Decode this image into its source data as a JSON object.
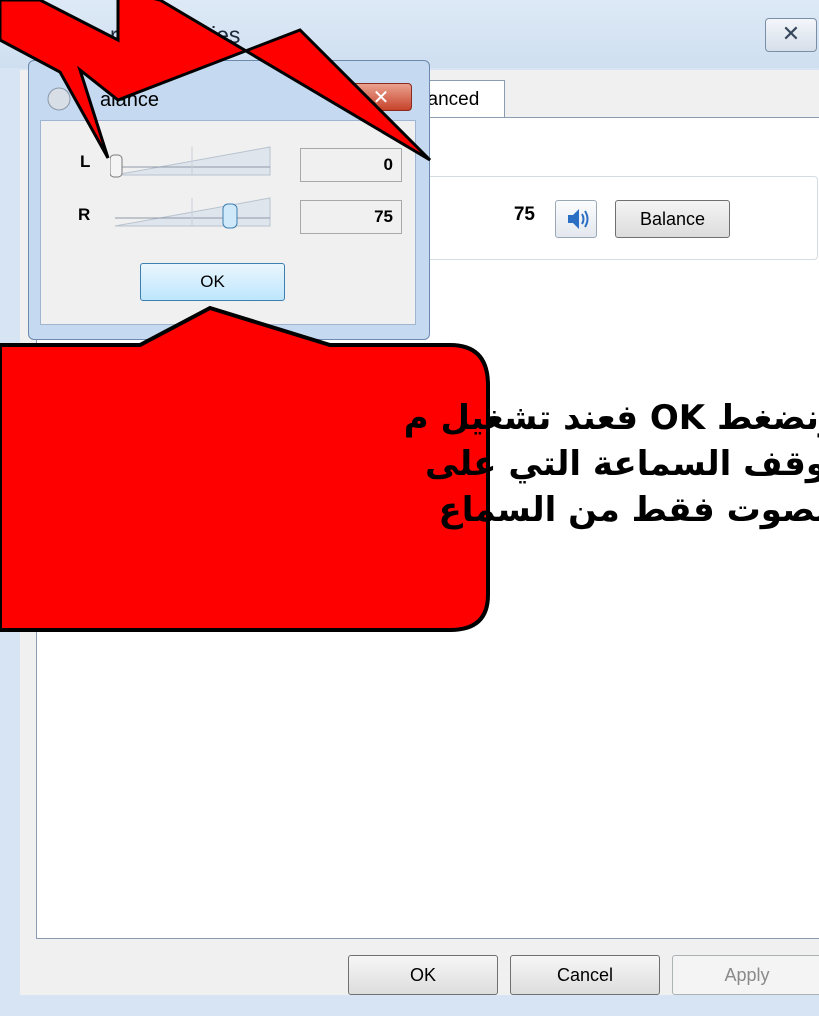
{
  "properties_window": {
    "title": "Speakers Properties",
    "title_visible": "rs Properties",
    "close_glyph": "✕",
    "tab_label": "Advanced",
    "tab_label_visible": "vanced",
    "level_value": "75",
    "balance_button": "Balance",
    "ok_button": "OK",
    "cancel_button": "Cancel",
    "apply_button": "Apply"
  },
  "balance_dialog": {
    "title": "Balance",
    "title_visible": "alance",
    "close_glyph": "✕",
    "channels": [
      {
        "label": "L",
        "value": "0",
        "level_percent": 0
      },
      {
        "label": "R",
        "value": "75",
        "level_percent": 75
      }
    ],
    "ok_button": "OK"
  },
  "callout": {
    "lines": [
      "ونضغط OK فعند تشغيل م",
      "توقف السماعة التي على",
      "الصوت فقط من السماع"
    ],
    "fill_color": "#ff0000"
  }
}
